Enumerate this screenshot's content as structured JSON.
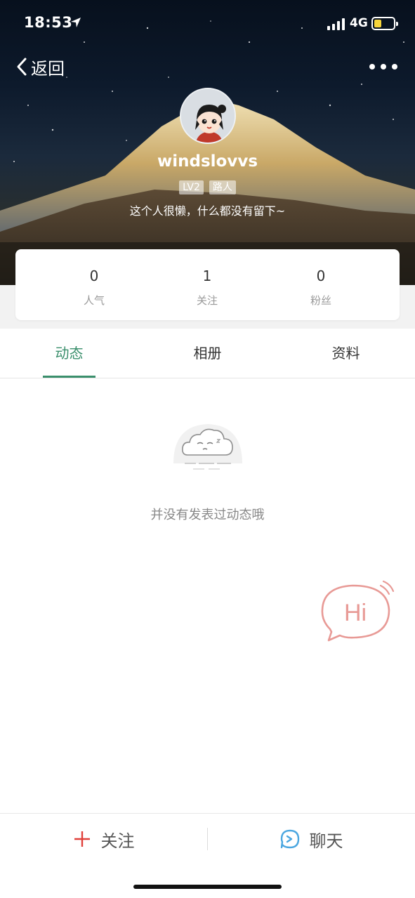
{
  "status_bar": {
    "time": "18:53",
    "network": "4G"
  },
  "nav": {
    "back_label": "返回"
  },
  "profile": {
    "username": "windslovvs",
    "level_badge": "LV2",
    "role_badge": "路人",
    "bio": "这个人很懒，什么都没有留下~"
  },
  "stats": [
    {
      "value": "0",
      "label": "人气"
    },
    {
      "value": "1",
      "label": "关注"
    },
    {
      "value": "0",
      "label": "粉丝"
    }
  ],
  "tabs": [
    {
      "label": "动态",
      "active": true
    },
    {
      "label": "相册",
      "active": false
    },
    {
      "label": "资料",
      "active": false
    }
  ],
  "empty_state": {
    "message": "并没有发表过动态哦"
  },
  "hi_bubble": {
    "text": "Hi"
  },
  "bottom_bar": {
    "follow_label": "关注",
    "chat_label": "聊天"
  },
  "colors": {
    "accent": "#3a8f6c",
    "follow_plus": "#e0403a",
    "chat_icon": "#4aa6e0",
    "hi_bubble": "#e89a96"
  }
}
